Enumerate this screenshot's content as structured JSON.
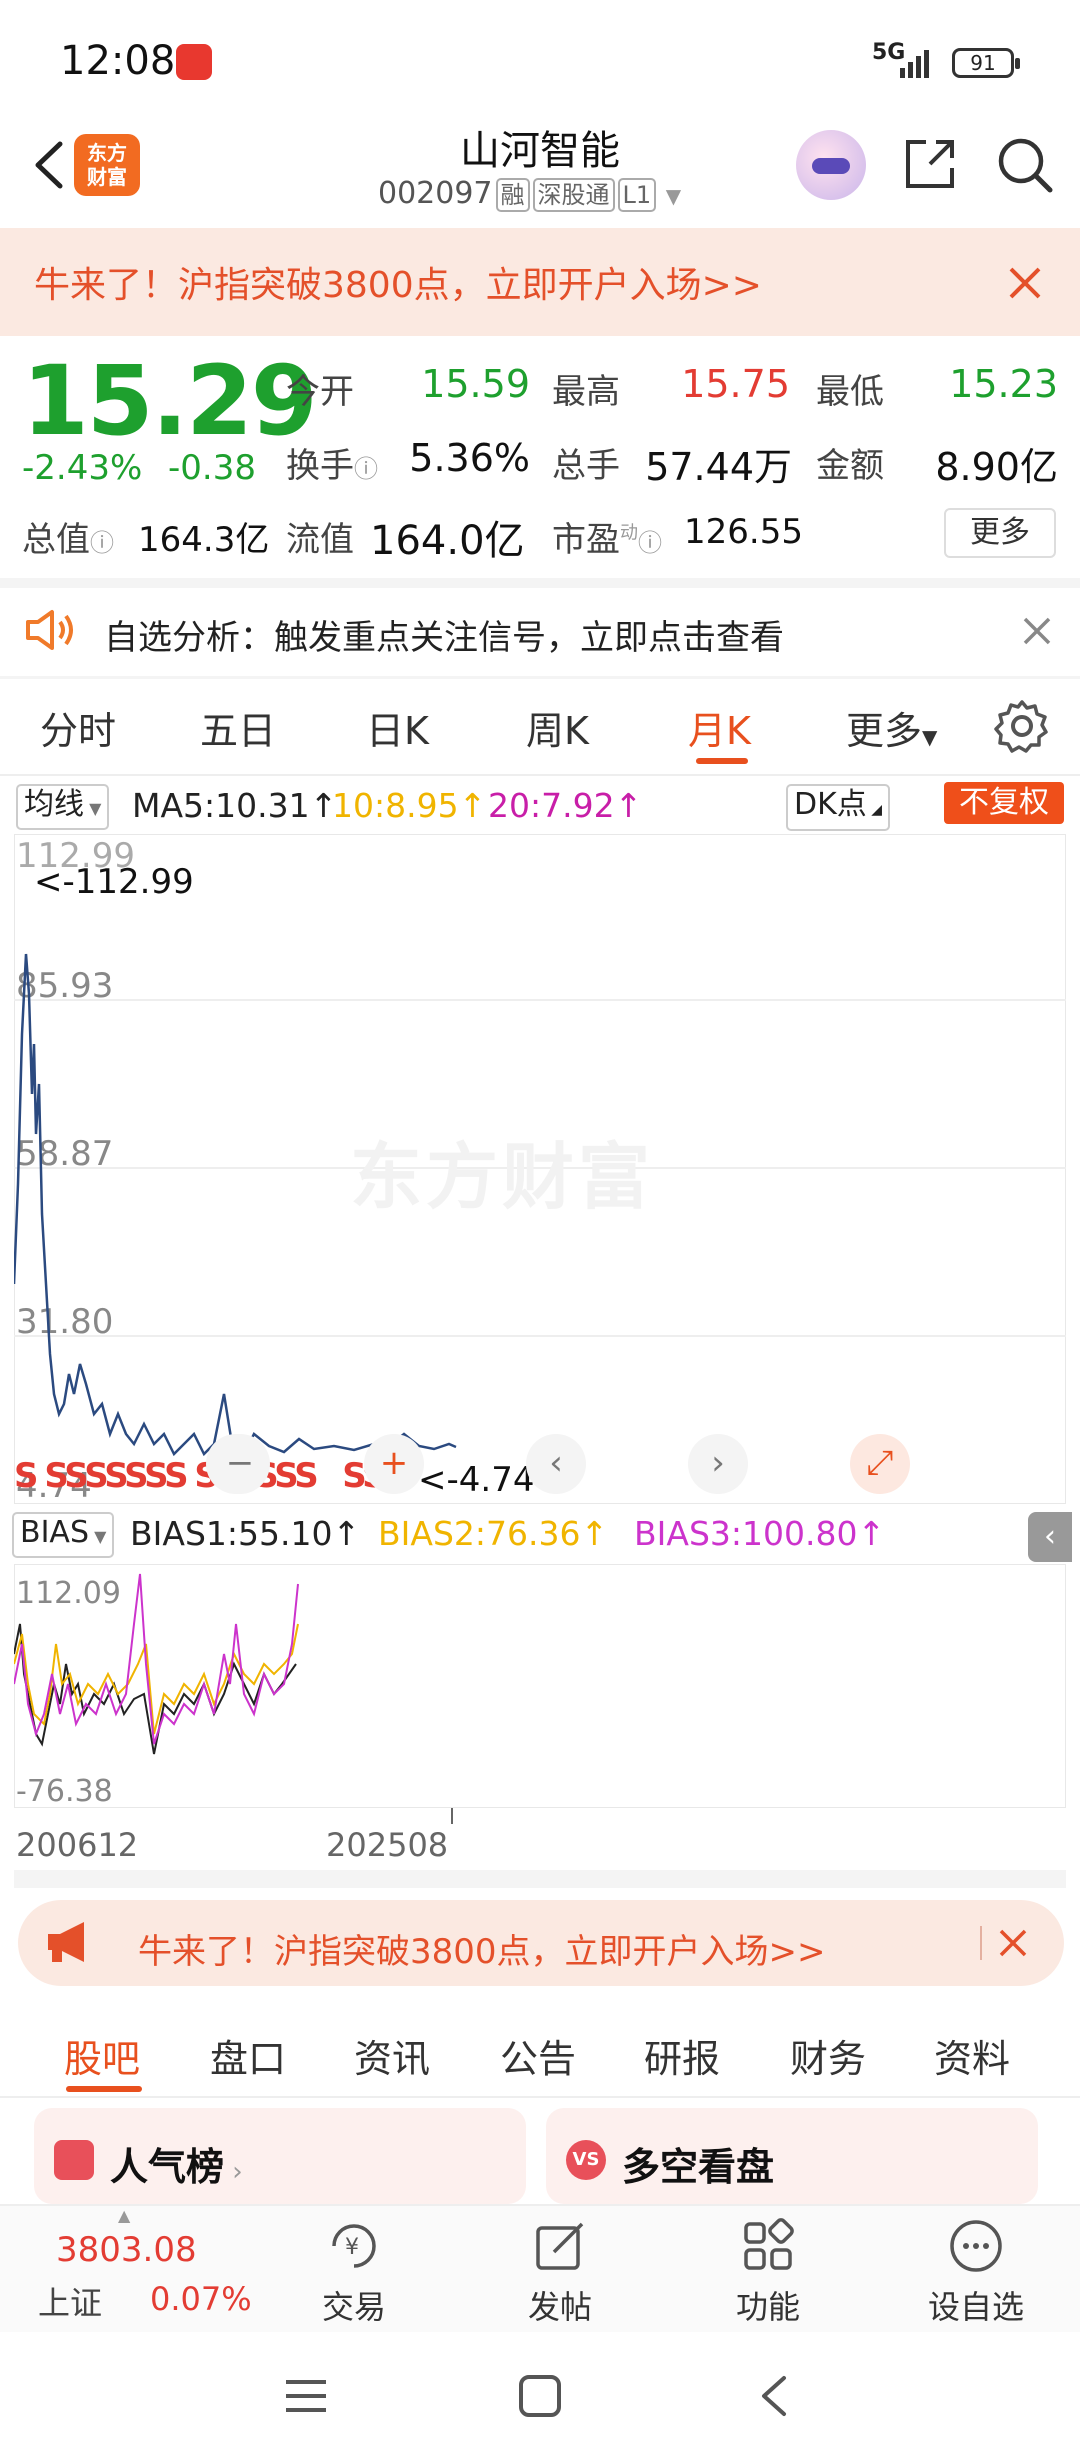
{
  "status_bar": {
    "time": "12:08",
    "network": "5G",
    "battery": "91"
  },
  "header": {
    "logo_text": "东方财富",
    "stock_name": "山河智能",
    "stock_code": "002097",
    "tags": [
      "融",
      "深股通",
      "L1"
    ]
  },
  "promo_banner": {
    "text": "牛来了！沪指突破3800点，立即开户入场>>"
  },
  "quote": {
    "price": "15.29",
    "change_pct": "-2.43%",
    "change_amt": "-0.38",
    "open_label": "今开",
    "open": "15.59",
    "high_label": "最高",
    "high": "15.75",
    "low_label": "最低",
    "low": "15.23",
    "turnover_label": "换手",
    "turnover": "5.36%",
    "volume_label": "总手",
    "volume": "57.44万",
    "amount_label": "金额",
    "amount": "8.90亿",
    "mktcap_label": "总值",
    "mktcap": "164.3亿",
    "float_label": "流值",
    "float": "164.0亿",
    "pe_label": "市盈",
    "pe_sup": "动",
    "pe": "126.55",
    "more_label": "更多"
  },
  "analysis_bar": {
    "text": "自选分析：触发重点关注信号，立即点击查看"
  },
  "tabs": [
    "分时",
    "五日",
    "日K",
    "周K",
    "月K",
    "更多"
  ],
  "active_tab": "月K",
  "ma_row": {
    "select": "均线",
    "ma5": "MA5:10.31",
    "ma10": "10:8.95",
    "ma20": "20:7.92",
    "dk": "DK点",
    "adjust": "不复权"
  },
  "main_chart": {
    "y_labels": [
      "112.99",
      "85.93",
      "58.87",
      "31.80",
      "4.74"
    ],
    "max_marker": "<-112.99",
    "min_marker": "<-4.74",
    "signals": "S SSSSSSS SSSSSS   SS",
    "watermark": "东方财富"
  },
  "bias_row": {
    "select": "BIAS",
    "bias1": "BIAS1:55.10",
    "bias2": "BIAS2:76.36",
    "bias3": "BIAS3:100.80"
  },
  "bias_chart": {
    "y_max": "112.09",
    "y_min": "-76.38"
  },
  "x_axis": {
    "start": "200612",
    "end": "202508"
  },
  "colors": {
    "up_red": "#e33c33",
    "down_green": "#1ea02e",
    "accent": "#e8501e",
    "ma5": "#2b4a80",
    "ma10": "#f0b400",
    "ma20": "#c81ea8",
    "bias1": "#222222",
    "bias2": "#f0b400",
    "bias3": "#cc33cc"
  },
  "promo_banner2": {
    "text": "牛来了！沪指突破3800点，立即开户入场>>"
  },
  "sub_tabs": [
    "股吧",
    "盘口",
    "资讯",
    "公告",
    "研报",
    "财务",
    "资料"
  ],
  "active_sub_tab": "股吧",
  "cards": [
    {
      "title": "人气榜"
    },
    {
      "title": "多空看盘"
    }
  ],
  "bottom_nav": {
    "index_value": "3803.08",
    "index_name": "上证",
    "index_change": "0.07%",
    "items": [
      "交易",
      "发帖",
      "功能",
      "设自选"
    ]
  }
}
